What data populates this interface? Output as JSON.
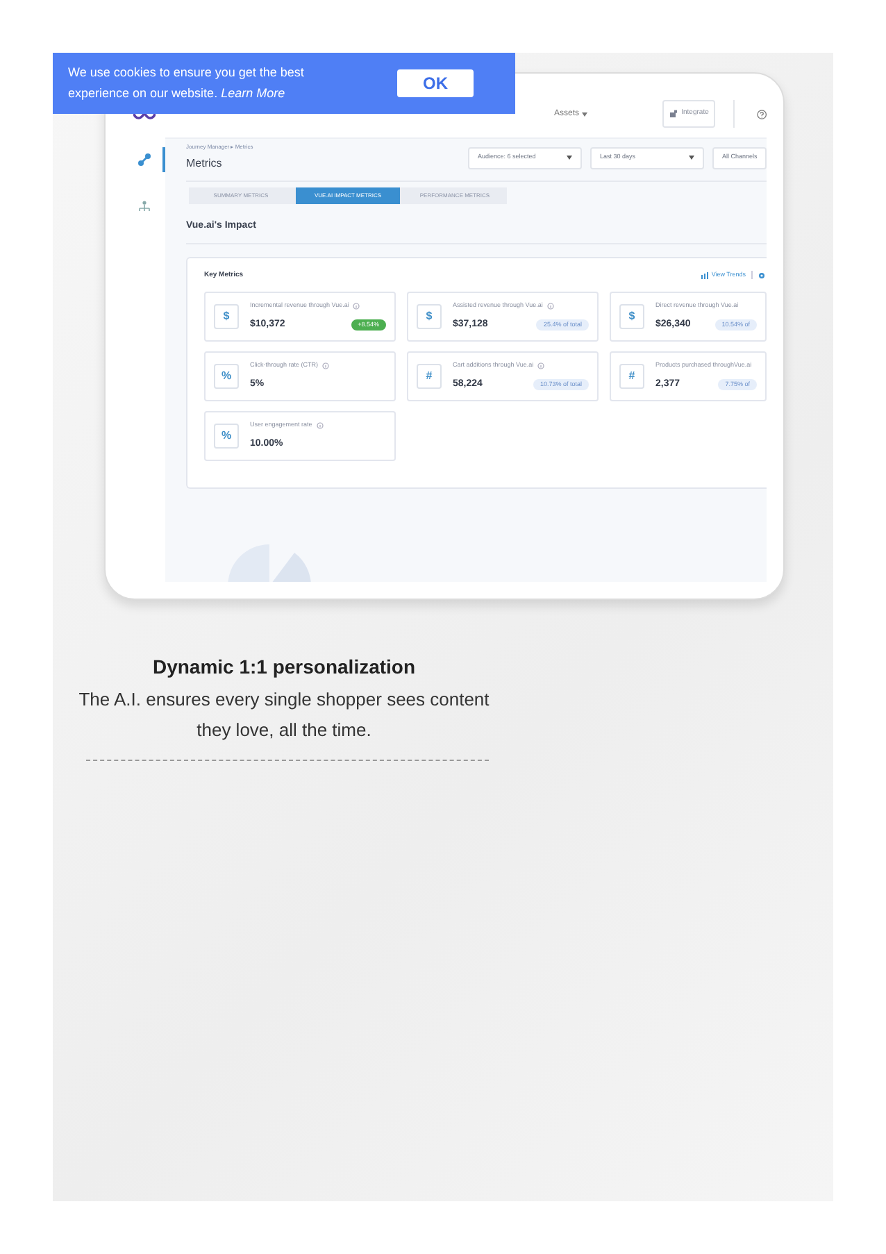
{
  "cookie_banner": {
    "message": "We use cookies to ensure you get the best experience on our website.",
    "link": "Learn More",
    "button": "OK"
  },
  "app": {
    "nav": {
      "assets": "Assets",
      "integrate": "Integrate"
    },
    "breadcrumb": "Journey Manager ▸ Metrics",
    "title": "Metrics",
    "filters": [
      "Audience: 6 selected",
      "Last 30 days",
      "All Channels"
    ],
    "tabs": [
      {
        "label": "SUMMARY METRICS",
        "selected": false
      },
      {
        "label": "VUE.AI IMPACT METRICS",
        "selected": true
      },
      {
        "label": "PERFORMANCE METRICS",
        "selected": false
      }
    ],
    "section_title": "Vue.ai's Impact",
    "panel": {
      "title": "Key Metrics",
      "link": "View Trends"
    },
    "metrics": [
      {
        "symbol": "$",
        "label": "Incremental revenue through Vue.ai",
        "value": "$10,372",
        "badge": "+8.54%",
        "kind": "growth"
      },
      {
        "symbol": "$",
        "label": "Assisted revenue through Vue.ai",
        "value": "$37,128",
        "badge": "25.4% of total",
        "kind": "share"
      },
      {
        "symbol": "$",
        "label": "Direct revenue through Vue.ai",
        "value": "$26,340",
        "badge": "10.54% of",
        "kind": "share"
      },
      {
        "symbol": "%",
        "label": "Click-through rate (CTR)",
        "value": "5%"
      },
      {
        "symbol": "#",
        "label": "Cart additions through Vue.ai",
        "value": "58,224",
        "badge": "10.73% of total",
        "kind": "share"
      },
      {
        "symbol": "#",
        "label": "Products purchased throughVue.ai",
        "value": "2,377",
        "badge": "7.75% of",
        "kind": "share"
      },
      {
        "symbol": "%",
        "label": "User engagement rate",
        "value": "10.00%"
      }
    ]
  },
  "caption": {
    "title": "Dynamic 1:1 personalization",
    "text": "The A.I. ensures every single shopper sees content they love, all the time."
  }
}
